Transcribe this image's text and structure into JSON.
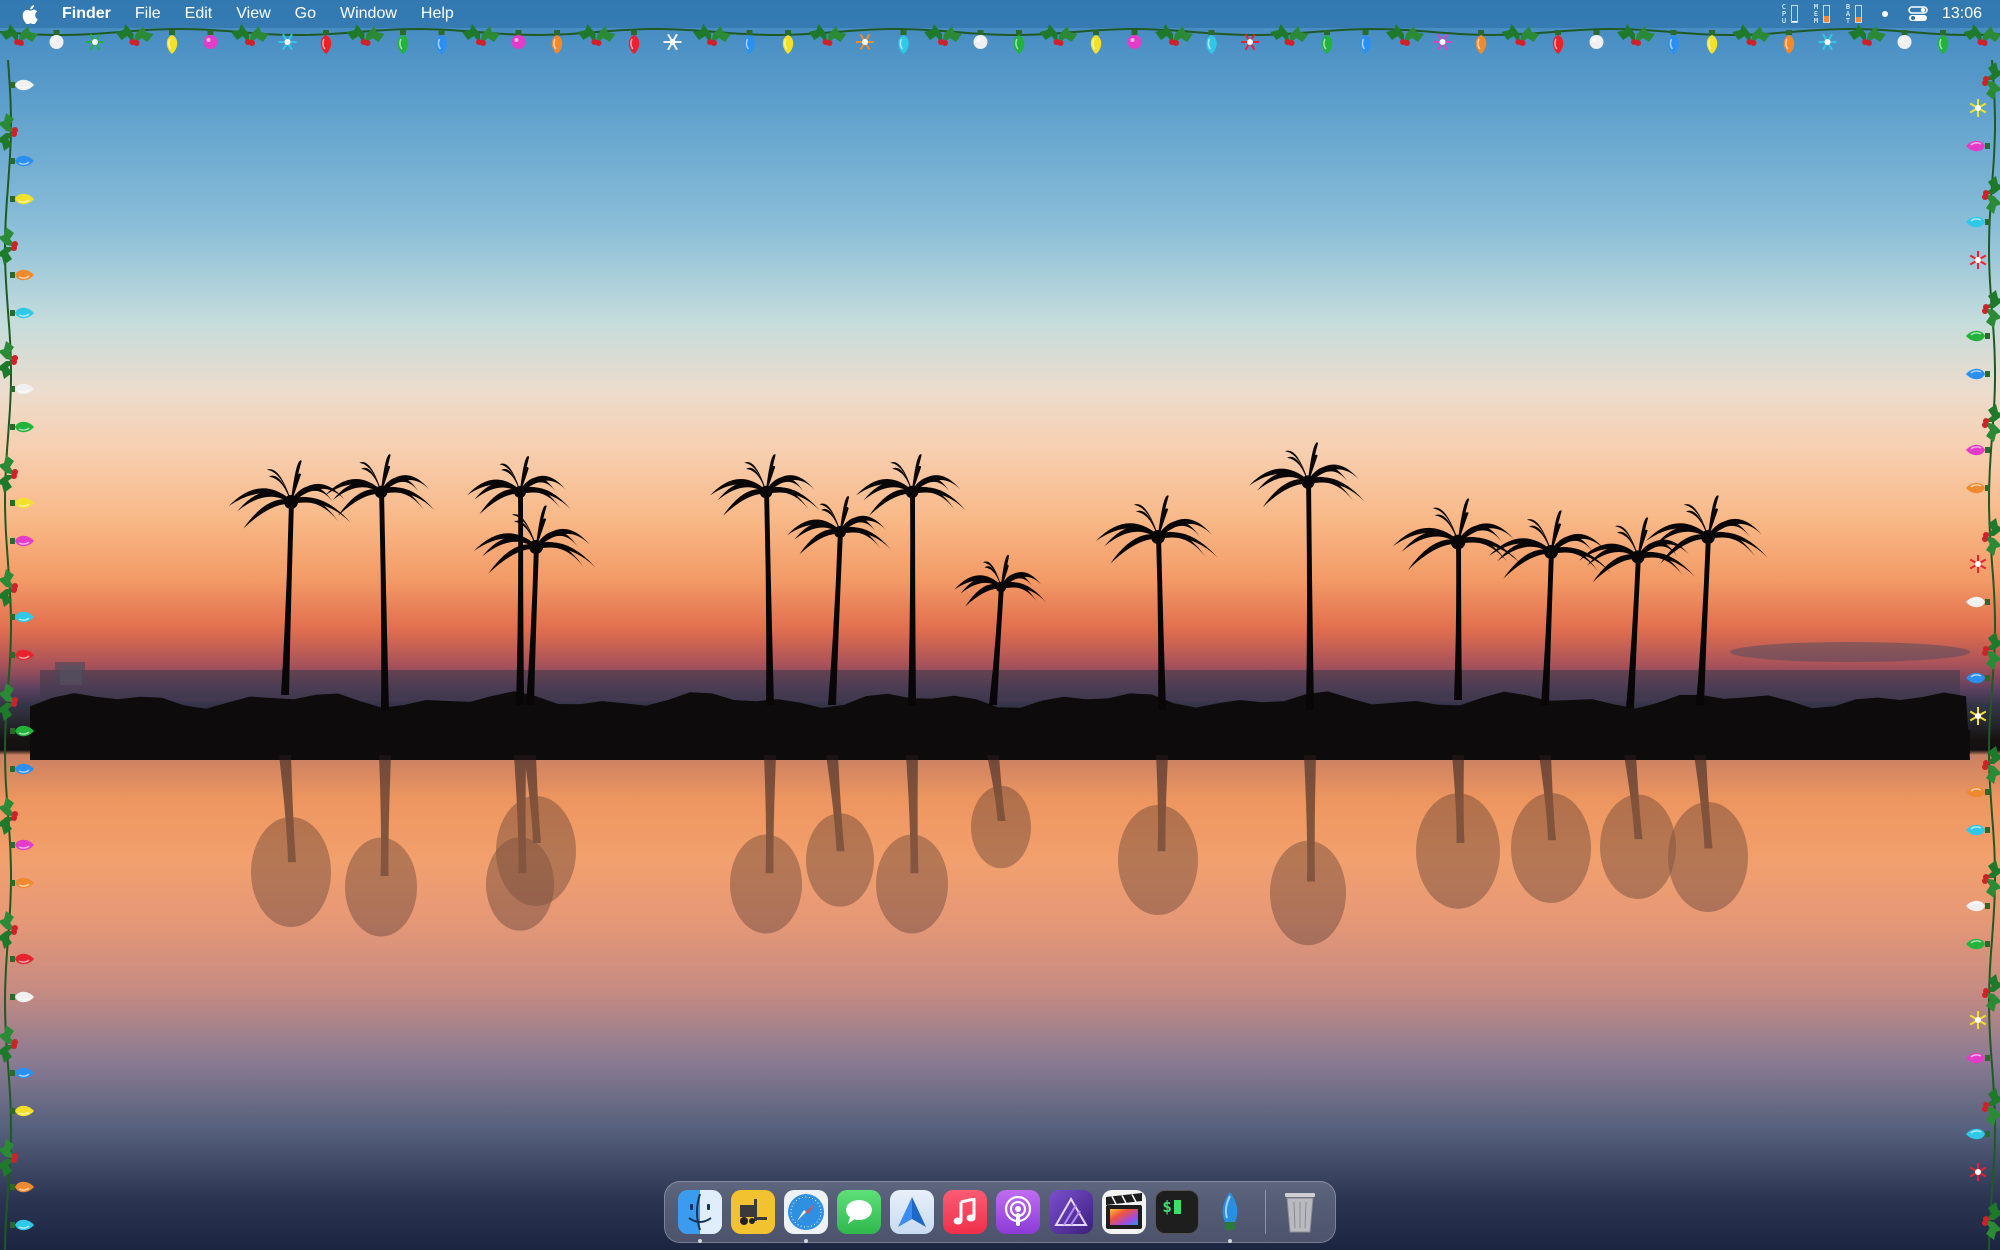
{
  "menubar": {
    "apple_icon": "apple-logo-icon",
    "app_name": "Finder",
    "menus": [
      "File",
      "Edit",
      "View",
      "Go",
      "Window",
      "Help"
    ],
    "stats": [
      {
        "label": "CPU",
        "level": 0.05,
        "color": "#ffffff"
      },
      {
        "label": "MEM",
        "level": 0.4,
        "color": "#f08a3a"
      },
      {
        "label": "BAT",
        "level": 0.3,
        "color": "#f08a3a"
      }
    ],
    "control_center_icon": "control-center-icon",
    "clock": "13:06"
  },
  "dock": {
    "apps": [
      {
        "name": "finder",
        "icon": "finder-icon",
        "color": "#2d8cf0",
        "running": true
      },
      {
        "name": "forklift",
        "icon": "forklift-icon",
        "color": "#f2c230",
        "running": false
      },
      {
        "name": "safari",
        "icon": "safari-icon",
        "color": "#2f8fe0",
        "running": true
      },
      {
        "name": "messages",
        "icon": "messages-icon",
        "color": "#34c759",
        "running": false
      },
      {
        "name": "spark",
        "icon": "spark-mail-icon",
        "color": "#3a86e8",
        "running": false
      },
      {
        "name": "music",
        "icon": "music-icon",
        "color": "#f0435a",
        "running": false
      },
      {
        "name": "podcasts",
        "icon": "podcasts-icon",
        "color": "#9b4fdc",
        "running": false
      },
      {
        "name": "affinity-photo",
        "icon": "affinity-photo-icon",
        "color": "#6b3fb4",
        "running": false
      },
      {
        "name": "final-cut-pro",
        "icon": "final-cut-pro-icon",
        "color": "#2a2a2a",
        "running": false
      },
      {
        "name": "terminal",
        "icon": "terminal-icon",
        "color": "#1e1e1e",
        "running": false
      },
      {
        "name": "xmas-lights",
        "icon": "christmas-bulb-icon",
        "color": "#2b8fe0",
        "running": true
      }
    ],
    "trash_icon": "trash-icon",
    "terminal_glyph": "$"
  }
}
